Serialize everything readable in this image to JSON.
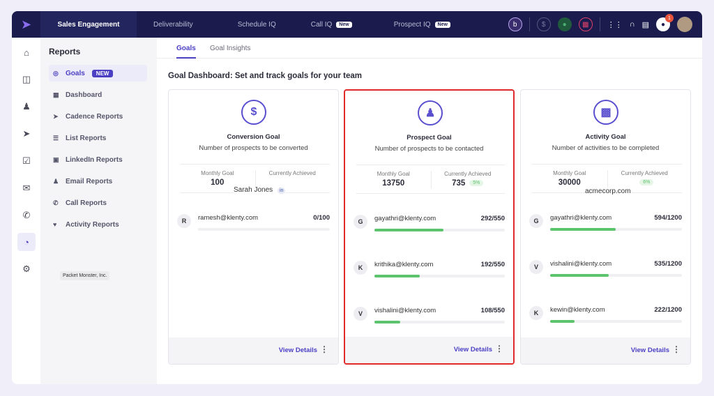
{
  "topbar": {
    "tabs": [
      {
        "label": "Sales Engagement",
        "active": true
      },
      {
        "label": "Deliverability"
      },
      {
        "label": "Schedule IQ"
      },
      {
        "label": "Call IQ",
        "badge": "New"
      },
      {
        "label": "Prospect IQ",
        "badge": "New"
      }
    ],
    "notification_count": "1",
    "icons": [
      "logo",
      "b-icon",
      "dollar-icon",
      "user-icon",
      "chart-icon",
      "dialpad-icon",
      "headset-icon",
      "book-icon",
      "bell-icon",
      "avatar"
    ]
  },
  "rail": {
    "icons": [
      "home",
      "inbox",
      "contacts",
      "send",
      "tasks",
      "mail",
      "phone",
      "reports",
      "settings"
    ],
    "active": "reports"
  },
  "sidebar": {
    "title": "Reports",
    "items": [
      {
        "label": "Goals",
        "badge": "NEW",
        "active": true
      },
      {
        "label": "Dashboard"
      },
      {
        "label": "Cadence Reports"
      },
      {
        "label": "List Reports"
      },
      {
        "label": "LinkedIn Reports"
      },
      {
        "label": "Email Reports"
      },
      {
        "label": "Call Reports"
      },
      {
        "label": "Activity Reports"
      }
    ],
    "org": "Packet Monster, Inc."
  },
  "main": {
    "tabs": [
      {
        "label": "Goals",
        "active": true
      },
      {
        "label": "Goal Insights"
      }
    ],
    "heading": "Goal Dashboard: Set and track goals for your team",
    "cards": [
      {
        "icon": "$",
        "title": "Conversion Goal",
        "subtitle": "Number of prospects to be converted",
        "monthly_label": "Monthly Goal",
        "monthly": "100",
        "achieved_label": "Currently Achieved",
        "achieved": "",
        "pct": "",
        "rows": [
          {
            "initial": "R",
            "email": "ramesh@klenty.com",
            "count": "0/100",
            "progress": 0
          }
        ],
        "view": "View Details"
      },
      {
        "icon": "person",
        "title": "Prospect Goal",
        "subtitle": "Number of prospects to be contacted",
        "monthly_label": "Monthly Goal",
        "monthly": "13750",
        "achieved_label": "Currently Achieved",
        "achieved": "735",
        "pct": "5%",
        "selected": true,
        "rows": [
          {
            "initial": "G",
            "email": "gayathri@klenty.com",
            "count": "292/550",
            "progress": 0.531
          },
          {
            "initial": "K",
            "email": "krithika@klenty.com",
            "count": "192/550",
            "progress": 0.349
          },
          {
            "initial": "V",
            "email": "vishalini@klenty.com",
            "count": "108/550",
            "progress": 0.196
          }
        ],
        "view": "View Details"
      },
      {
        "icon": "bars",
        "title": "Activity Goal",
        "subtitle": "Number of activities to be completed",
        "monthly_label": "Monthly Goal",
        "monthly": "30000",
        "achieved_label": "Currently Achieved",
        "achieved": "",
        "pct": "6%",
        "rows": [
          {
            "initial": "G",
            "email": "gayathri@klenty.com",
            "count": "594/1200",
            "progress": 0.495
          },
          {
            "initial": "V",
            "email": "vishalini@klenty.com",
            "count": "535/1200",
            "progress": 0.446
          },
          {
            "initial": "K",
            "email": "kewin@klenty.com",
            "count": "222/1200",
            "progress": 0.185
          }
        ],
        "view": "View Details"
      }
    ]
  },
  "overlays": {
    "name": "Sarah Jones",
    "domain": "acmecorp.com"
  },
  "colors": {
    "topbar": "#1b1c4d",
    "accent": "#4b40c4",
    "progress": "#5cc46c",
    "highlight": "#e02a2a"
  }
}
